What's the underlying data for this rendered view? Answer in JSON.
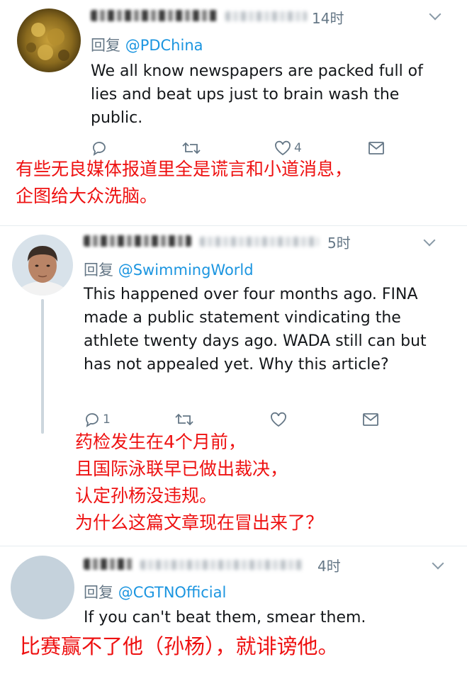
{
  "tweets": [
    {
      "time": "14时",
      "reply_prefix": "回复",
      "reply_to": "@PDChina",
      "text": "We all know newspapers are packed full of lies and beat ups just to brain wash the public.",
      "reply_count": "",
      "like_count": "4",
      "note_lines": [
        "有些无良媒体报道里全是谎言和小道消息，",
        "企图给大众洗脑。"
      ]
    },
    {
      "time": "5时",
      "reply_prefix": "回复",
      "reply_to": "@SwimmingWorld",
      "text": "This happened over four months ago. FINA made a public statement vindicating the athlete twenty days ago. WADA still can but has not appealed yet. Why this article?",
      "reply_count": "1",
      "like_count": "",
      "note_lines": [
        "药检发生在4个月前，",
        "且国际泳联早已做出裁决，",
        "认定孙杨没违规。",
        "为什么这篇文章现在冒出来了？"
      ]
    },
    {
      "time": "4时",
      "reply_prefix": "回复",
      "reply_to": "@CGTNOfficial",
      "text": "If you can't beat them, smear them.",
      "note_lines": [
        "比赛赢不了他（孙杨），就诽谤他。"
      ]
    }
  ],
  "colors": {
    "annotation": "#ee1111",
    "link": "#1b95e0",
    "secondary": "#657786"
  },
  "icons": [
    "reply-icon",
    "retweet-icon",
    "like-icon",
    "message-icon",
    "chevron-down-icon"
  ]
}
